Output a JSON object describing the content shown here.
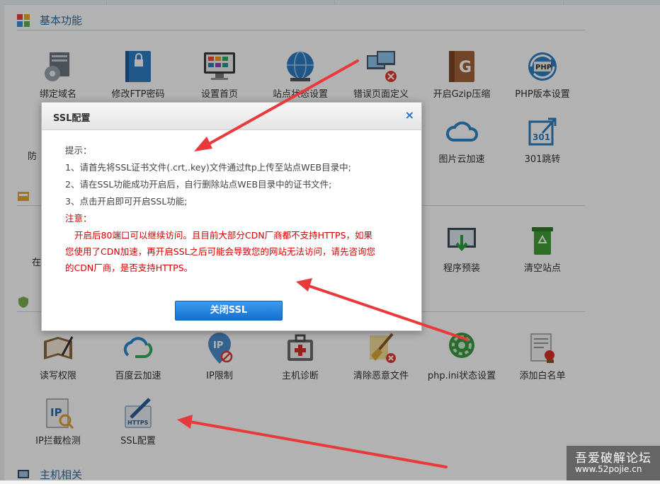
{
  "sections": {
    "basic": "基本功能",
    "host": "主机相关"
  },
  "tiles": {
    "bind_domain": "绑定域名",
    "ftp_password": "修改FTP密码",
    "homepage": "设置首页",
    "site_status": "站点状态设置",
    "error_page": "错误页面定义",
    "gzip": "开启Gzip压缩",
    "php_version": "PHP版本设置",
    "image_cloud": "图片云加速",
    "redirect_301": "301跳转",
    "program_preinstall": "程序预装",
    "clear_site": "清空站点",
    "rw_permission": "读写权限",
    "baidu_cloud": "百度云加速",
    "ip_limit": "IP限制",
    "host_diagnose": "主机诊断",
    "clean_malicious": "清除恶意文件",
    "phpini_status": "php.ini状态设置",
    "add_whitelist": "添加白名单",
    "ip_block_check": "IP拦截检测",
    "ssl_config": "SSL配置",
    "partial_1": "防",
    "partial_2": "在"
  },
  "icon_text": {
    "php_badge": "PHP",
    "r301": "301",
    "https_badge": "HTTPS",
    "ip_badge": "IP"
  },
  "dialog": {
    "title": "SSL配置",
    "close_symbol": "×",
    "tip_heading": "提示：",
    "tips": [
      "1、请首先将SSL证书文件(.crt,.key)文件通过ftp上传至站点WEB目录中;",
      "2、请在SSL功能成功开启后，自行删除站点WEB目录中的证书文件;",
      "3、点击开启即可开启SSL功能;"
    ],
    "note_heading": "注意：",
    "note_lines": [
      "开启后80端口可以继续访问。且目前大部分CDN厂商都不支持HTTPS，如果",
      "您使用了CDN加速，再开启SSL之后可能会导致您的网站无法访问，请先咨询您",
      "的CDN厂商，是否支持HTTPS。"
    ],
    "button": "关闭SSL"
  },
  "watermark": {
    "name": "吾爱破解论坛",
    "url": "www.52pojie.cn"
  },
  "colors": {
    "section_title": "#2d6fae",
    "note_red": "#d20000",
    "button_blue": "#1470d1",
    "arrow_red": "#e83a3a"
  }
}
